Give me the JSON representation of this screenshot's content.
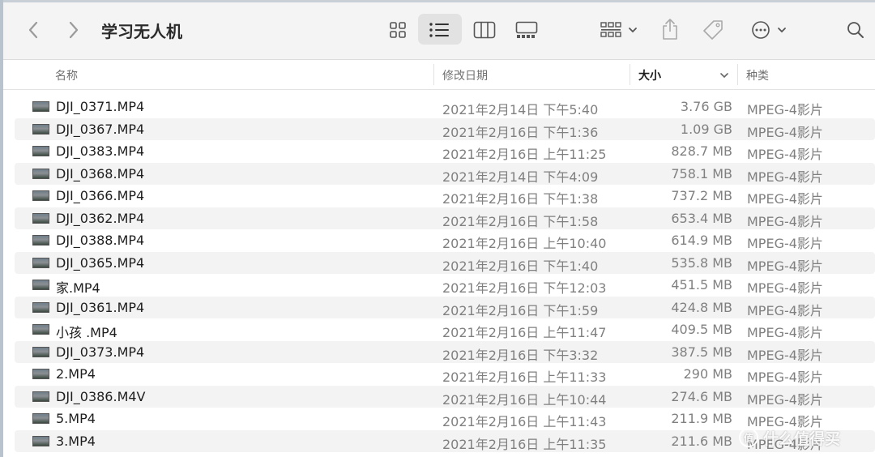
{
  "window": {
    "title": "学习无人机"
  },
  "toolbar": {
    "back_icon": "chevron-left-icon",
    "forward_icon": "chevron-right-icon",
    "view_icons": [
      "grid-view-icon",
      "list-view-icon",
      "column-view-icon",
      "gallery-view-icon"
    ],
    "active_view": "list-view-icon",
    "group_icon": "group-by-icon",
    "share_icon": "share-icon",
    "tag_icon": "tag-icon",
    "more_icon": "more-actions-icon",
    "search_icon": "search-icon"
  },
  "columns": {
    "name": "名称",
    "date": "修改日期",
    "size": "大小",
    "kind": "种类"
  },
  "sort": {
    "column": "size",
    "direction": "descending"
  },
  "files": [
    {
      "name": "DJI_0371.MP4",
      "date": "2021年2月14日 下午5:40",
      "size": "3.76 GB",
      "kind": "MPEG-4影片"
    },
    {
      "name": "DJI_0367.MP4",
      "date": "2021年2月16日 下午1:36",
      "size": "1.09 GB",
      "kind": "MPEG-4影片"
    },
    {
      "name": "DJI_0383.MP4",
      "date": "2021年2月16日 上午11:25",
      "size": "828.7 MB",
      "kind": "MPEG-4影片"
    },
    {
      "name": "DJI_0368.MP4",
      "date": "2021年2月14日 下午4:09",
      "size": "758.1 MB",
      "kind": "MPEG-4影片"
    },
    {
      "name": "DJI_0366.MP4",
      "date": "2021年2月16日 下午1:38",
      "size": "737.2 MB",
      "kind": "MPEG-4影片"
    },
    {
      "name": "DJI_0362.MP4",
      "date": "2021年2月16日 下午1:58",
      "size": "653.4 MB",
      "kind": "MPEG-4影片"
    },
    {
      "name": "DJI_0388.MP4",
      "date": "2021年2月16日 上午10:40",
      "size": "614.9 MB",
      "kind": "MPEG-4影片"
    },
    {
      "name": "DJI_0365.MP4",
      "date": "2021年2月16日 下午1:40",
      "size": "535.8 MB",
      "kind": "MPEG-4影片"
    },
    {
      "name": "家.MP4",
      "date": "2021年2月16日 下午12:03",
      "size": "451.5 MB",
      "kind": "MPEG-4影片"
    },
    {
      "name": "DJI_0361.MP4",
      "date": "2021年2月16日 下午1:59",
      "size": "424.8 MB",
      "kind": "MPEG-4影片"
    },
    {
      "name": "小孩 .MP4",
      "date": "2021年2月16日 上午11:47",
      "size": "409.5 MB",
      "kind": "MPEG-4影片"
    },
    {
      "name": "DJI_0373.MP4",
      "date": "2021年2月16日 下午3:32",
      "size": "387.5 MB",
      "kind": "MPEG-4影片"
    },
    {
      "name": "2.MP4",
      "date": "2021年2月16日 上午11:33",
      "size": "290 MB",
      "kind": "MPEG-4影片"
    },
    {
      "name": "DJI_0386.M4V",
      "date": "2021年2月16日 上午10:44",
      "size": "274.6 MB",
      "kind": "MPEG-4影片"
    },
    {
      "name": "5.MP4",
      "date": "2021年2月16日 上午11:43",
      "size": "211.9 MB",
      "kind": "MPEG-4影片"
    },
    {
      "name": "3.MP4",
      "date": "2021年2月16日 上午11:35",
      "size": "211.6 MB",
      "kind": "MPEG-4影片"
    }
  ],
  "watermark": {
    "text": "什么值得买",
    "mark": "值"
  }
}
